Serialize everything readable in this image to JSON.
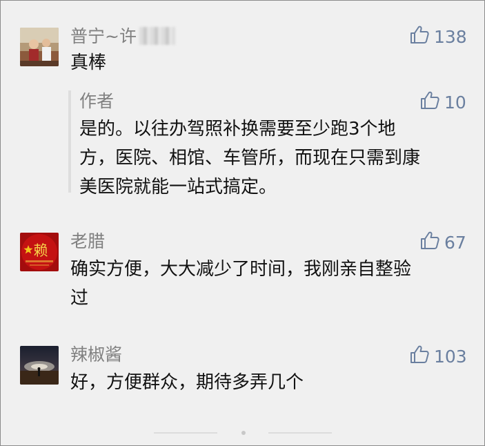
{
  "comments": [
    {
      "nickname": "普宁~许",
      "text": "真棒",
      "likes": "138",
      "reply": {
        "author": "作者",
        "likes": "10",
        "lines": [
          "是的。以往办驾照补换需要至少跑3个地",
          "方，医院、相馆、车管所，而现在只需到康",
          "美医院就能一站式搞定。"
        ]
      }
    },
    {
      "nickname": "老腊",
      "avatar_glyph": "赖",
      "lines": [
        "确实方便，大大减少了时间，我刚亲自整验",
        "过"
      ],
      "likes": "67"
    },
    {
      "nickname": "辣椒酱",
      "lines": [
        "好，方便群众，期待多弄几个"
      ],
      "likes": "103"
    }
  ],
  "icons": {
    "like": "thumbs-up-icon"
  },
  "colors": {
    "like": "#6a7f9f",
    "nickname": "#808080",
    "text": "#111111",
    "background": "#f0f0f0"
  }
}
